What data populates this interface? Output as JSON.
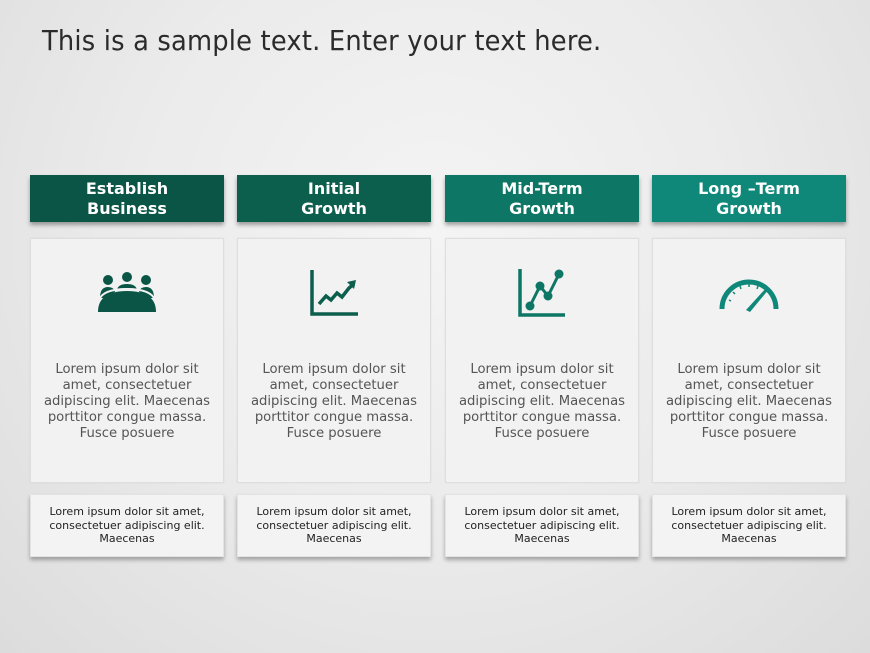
{
  "title": "This is a sample text. Enter your text here.",
  "columns": [
    {
      "header": "Establish\nBusiness",
      "header_color": "#0a5546",
      "icon": "team-meeting-icon",
      "icon_color": "#0a5546",
      "body": "Lorem ipsum  dolor sit amet, consectetuer adipiscing  elit.  Maecenas porttitor congue massa. Fusce posuere",
      "note": "Lorem ipsum dolor sit amet, consectetuer adipiscing elit. Maecenas"
    },
    {
      "header": "Initial\nGrowth",
      "header_color": "#0c5e4d",
      "icon": "growth-chart-icon",
      "icon_color": "#0c5e4d",
      "body": "Lorem ipsum  dolor sit amet, consectetuer adipiscing  elit.  Maecenas porttitor congue massa. Fusce posuere",
      "note": "Lorem ipsum dolor sit amet, consectetuer adipiscing elit. Maecenas"
    },
    {
      "header": "Mid-Term\nGrowth",
      "header_color": "#0e7664",
      "icon": "line-chart-icon",
      "icon_color": "#0e7664",
      "body": "Lorem ipsum  dolor sit amet, consectetuer adipiscing  elit.  Maecenas porttitor congue massa. Fusce posuere",
      "note": "Lorem ipsum dolor sit amet, consectetuer adipiscing elit. Maecenas"
    },
    {
      "header": "Long –Term\nGrowth",
      "header_color": "#0f887a",
      "icon": "speedometer-icon",
      "icon_color": "#0f887a",
      "body": "Lorem ipsum  dolor sit amet, consectetuer adipiscing  elit.  Maecenas porttitor congue massa. Fusce posuere",
      "note": "Lorem ipsum dolor sit amet, consectetuer adipiscing elit. Maecenas"
    }
  ]
}
